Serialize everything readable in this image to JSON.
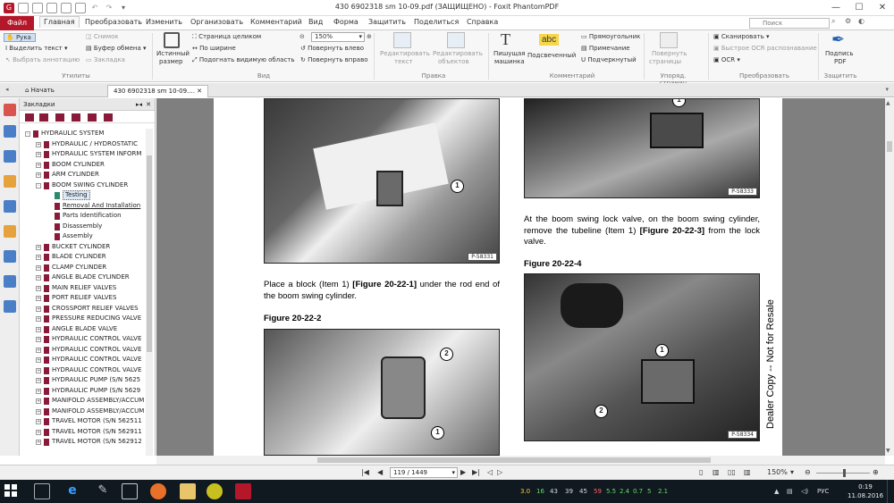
{
  "window": {
    "title": "430 6902318 sm 10-09.pdf (ЗАЩИЩЕНО) - Foxit PhantomPDF"
  },
  "ribbon_tabs": [
    "Файл",
    "Главная",
    "Преобразовать",
    "Изменить",
    "Организовать",
    "Комментарий",
    "Вид",
    "Форма",
    "Защитить",
    "Поделиться",
    "Справка"
  ],
  "search": {
    "placeholder": "Поиск"
  },
  "ribbon": {
    "hand": "Рука",
    "select_text": "Выделить текст",
    "select_annot": "Выбрать аннотацию",
    "snapshot": "Снимок",
    "clipboard": "Буфер обмена",
    "bookmark": "Закладка",
    "group_tools": "Утилиты",
    "actual_size_1": "Истинный",
    "actual_size_2": "размер",
    "fit_page": "Страница целиком",
    "fit_width": "По ширине",
    "fit_visible": "Подогнать видимую область",
    "zoom_value": "150%",
    "rotate_left": "Повернуть влево",
    "rotate_right": "Повернуть вправо",
    "group_view": "Вид",
    "edit_text_1": "Редактировать",
    "edit_text_2": "текст",
    "edit_obj_1": "Редактировать",
    "edit_obj_2": "объектов",
    "group_edit": "Правка",
    "typewriter_1": "Пишущая",
    "typewriter_2": "машинка",
    "highlight": "Подсвеченный",
    "abc": "abc",
    "rect": "Прямоугольник",
    "note": "Примечание",
    "underline": "Подчеркнутый",
    "group_comment": "Комментарий",
    "pages_1": "Повернуть",
    "pages_2": "страницы",
    "group_pages": "Упоряд. страниц",
    "scan": "Сканировать",
    "quick_ocr": "Быстрое OCR распознавание",
    "ocr": "OCR",
    "group_convert": "Преобразовать",
    "sign_1": "Подпись",
    "sign_2": "PDF",
    "group_protect": "Защитить"
  },
  "doc_tabs": [
    "Начать",
    "430 6902318 sm 10-09...."
  ],
  "bookmarks_panel": {
    "title": "Закладки"
  },
  "bookmarks": [
    {
      "label": "HYDRAULIC SYSTEM",
      "level": 0,
      "exp": "-"
    },
    {
      "label": "HYDRAULIC / HYDROSTATIC",
      "level": 1,
      "exp": "+"
    },
    {
      "label": "HYDRAULIC SYSTEM INFORM",
      "level": 1,
      "exp": "+"
    },
    {
      "label": "BOOM CYLINDER",
      "level": 1,
      "exp": "+"
    },
    {
      "label": "ARM CYLINDER",
      "level": 1,
      "exp": "+"
    },
    {
      "label": "BOOM SWING CYLINDER",
      "level": 1,
      "exp": "-"
    },
    {
      "label": "Testing",
      "level": 2,
      "exp": "",
      "sel": true
    },
    {
      "label": "Removal And Installation",
      "level": 2,
      "exp": "",
      "ul": true
    },
    {
      "label": "Parts Identification",
      "level": 2,
      "exp": ""
    },
    {
      "label": "Disassembly",
      "level": 2,
      "exp": ""
    },
    {
      "label": "Assembly",
      "level": 2,
      "exp": ""
    },
    {
      "label": "BUCKET CYLINDER",
      "level": 1,
      "exp": "+"
    },
    {
      "label": "BLADE CYLINDER",
      "level": 1,
      "exp": "+"
    },
    {
      "label": "CLAMP CYLINDER",
      "level": 1,
      "exp": "+"
    },
    {
      "label": "ANGLE BLADE CYLINDER",
      "level": 1,
      "exp": "+"
    },
    {
      "label": "MAIN RELIEF VALVES",
      "level": 1,
      "exp": "+"
    },
    {
      "label": "PORT RELIEF VALVES",
      "level": 1,
      "exp": "+"
    },
    {
      "label": "CROSSPORT RELIEF VALVES",
      "level": 1,
      "exp": "+"
    },
    {
      "label": "PRESSURE REDUCING VALVE",
      "level": 1,
      "exp": "+"
    },
    {
      "label": "ANGLE BLADE VALVE",
      "level": 1,
      "exp": "+"
    },
    {
      "label": "HYDRAULIC CONTROL VALVE",
      "level": 1,
      "exp": "+"
    },
    {
      "label": "HYDRAULIC CONTROL VALVE",
      "level": 1,
      "exp": "+"
    },
    {
      "label": "HYDRAULIC CONTROL VALVE",
      "level": 1,
      "exp": "+"
    },
    {
      "label": "HYDRAULIC CONTROL VALVE",
      "level": 1,
      "exp": "+"
    },
    {
      "label": "HYDRAULIC PUMP (S/N 5625",
      "level": 1,
      "exp": "+"
    },
    {
      "label": "HYDRAULIC PUMP (S/N 5629",
      "level": 1,
      "exp": "+"
    },
    {
      "label": "MANIFOLD ASSEMBLY/ACCUM",
      "level": 1,
      "exp": "+"
    },
    {
      "label": "MANIFOLD ASSEMBLY/ACCUM",
      "level": 1,
      "exp": "+"
    },
    {
      "label": "TRAVEL MOTOR (S/N 562511",
      "level": 1,
      "exp": "+"
    },
    {
      "label": "TRAVEL MOTOR (S/N 562911",
      "level": 1,
      "exp": "+"
    },
    {
      "label": "TRAVEL MOTOR (S/N 562912",
      "level": 1,
      "exp": "+"
    }
  ],
  "page": {
    "photo1_num": "P-58331",
    "photo2_num": "P-58333",
    "photo3_num": "P-58334",
    "para1_a": "Place a block (Item 1) ",
    "para1_ref": "[Figure 20-22-1]",
    "para1_b": " under the rod end of the boom swing cylinder.",
    "fig2": "Figure 20-22-2",
    "para2_a": "At the boom swing lock valve, on the boom swing cylinder, remove the tubeline (Item 1) ",
    "para2_ref": "[Figure 20-22-3]",
    "para2_b": " from the lock valve.",
    "fig4": "Figure 20-22-4",
    "side_text": "Dealer Copy -- Not for Resale",
    "c1": "1",
    "c2": "2"
  },
  "status": {
    "page_box": "119 / 1449",
    "zoom": "150%"
  },
  "taskbar": {
    "sys_nums": [
      "3.0",
      "16",
      "43",
      "39",
      "45",
      "59",
      "5.5",
      "2.4",
      "0.7",
      "5",
      "2.1"
    ],
    "lang": "РУС",
    "time": "0:19",
    "date": "11.08.2016"
  },
  "colors": {
    "file_tab": "#b5172a",
    "accent": "#1f5fb4",
    "bookmark": "#8a1a3a",
    "taskbar": "#101820"
  }
}
